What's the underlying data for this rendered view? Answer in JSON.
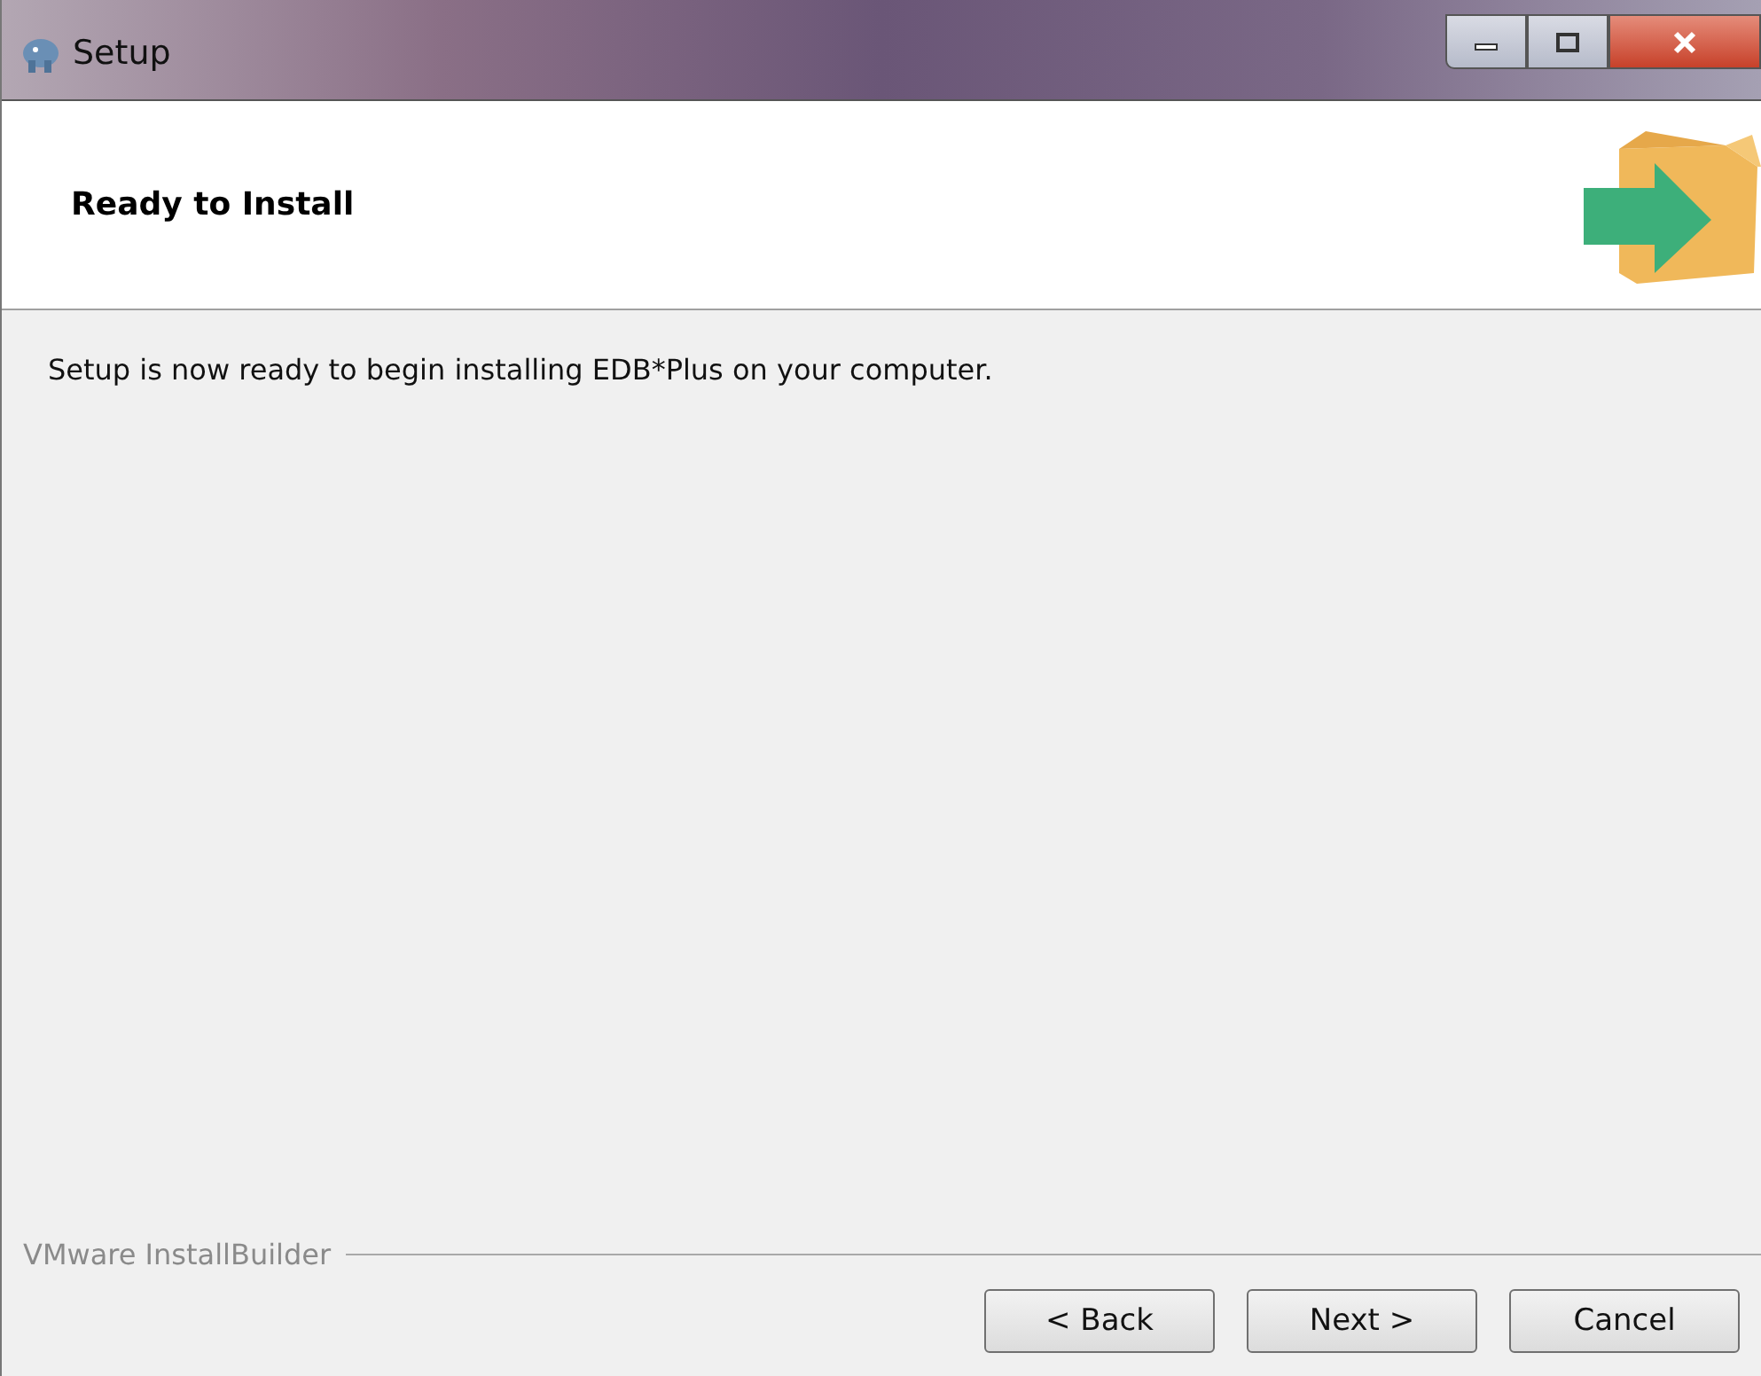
{
  "window": {
    "title": "Setup"
  },
  "header": {
    "title": "Ready to Install"
  },
  "message": "Setup is now ready to begin installing EDB*Plus on your computer.",
  "footer": {
    "brand": "VMware InstallBuilder"
  },
  "buttons": [
    "< Back",
    "Next >",
    "Cancel"
  ]
}
